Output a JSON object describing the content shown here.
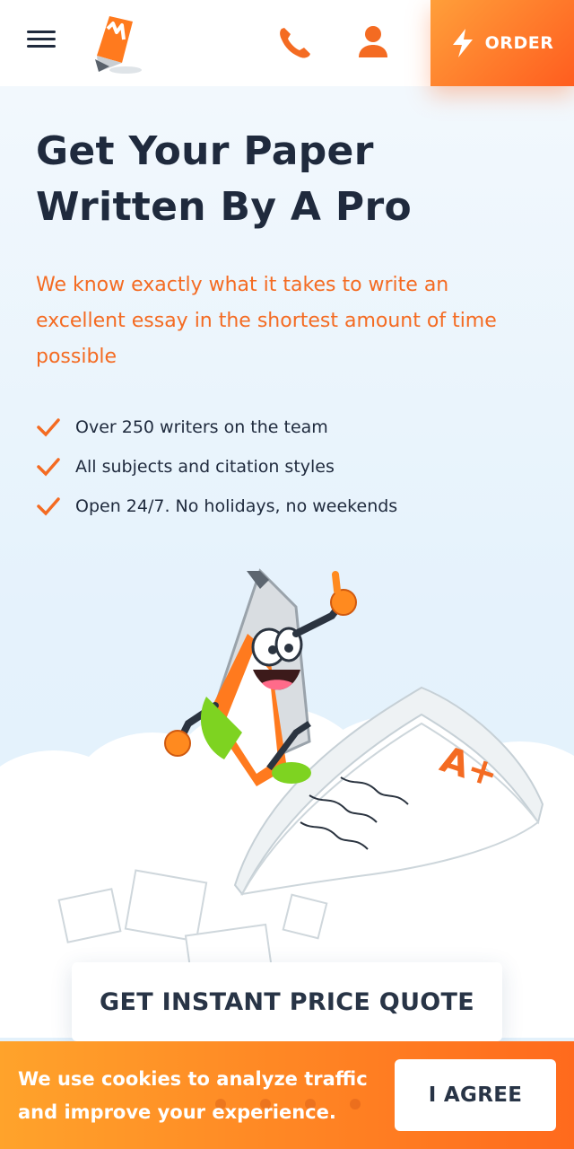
{
  "header": {
    "menu_icon": "hamburger-menu-icon",
    "logo_icon": "pencil-logo-icon",
    "phone_icon": "phone-icon",
    "user_icon": "user-icon",
    "order_icon": "lightning-icon",
    "order_label": "ORDER"
  },
  "hero": {
    "title": "Get Your Paper Written By A Pro",
    "subtitle": "We know exactly what it takes to write an excellent essay in the shortest amount of time possible",
    "features": [
      "Over 250 writers on the team",
      "All subjects and citation styles",
      "Open 24/7. No holidays, no weekends"
    ],
    "paper_grade": "A+",
    "quote_button": "GET INSTANT PRICE QUOTE"
  },
  "cookie": {
    "text": "We use cookies to analyze traffic and improve your experience.",
    "agree_label": "I AGREE"
  },
  "colors": {
    "accent": "#f46b22",
    "dark_text": "#1f2a3d",
    "bg": "#e6f3fc"
  }
}
